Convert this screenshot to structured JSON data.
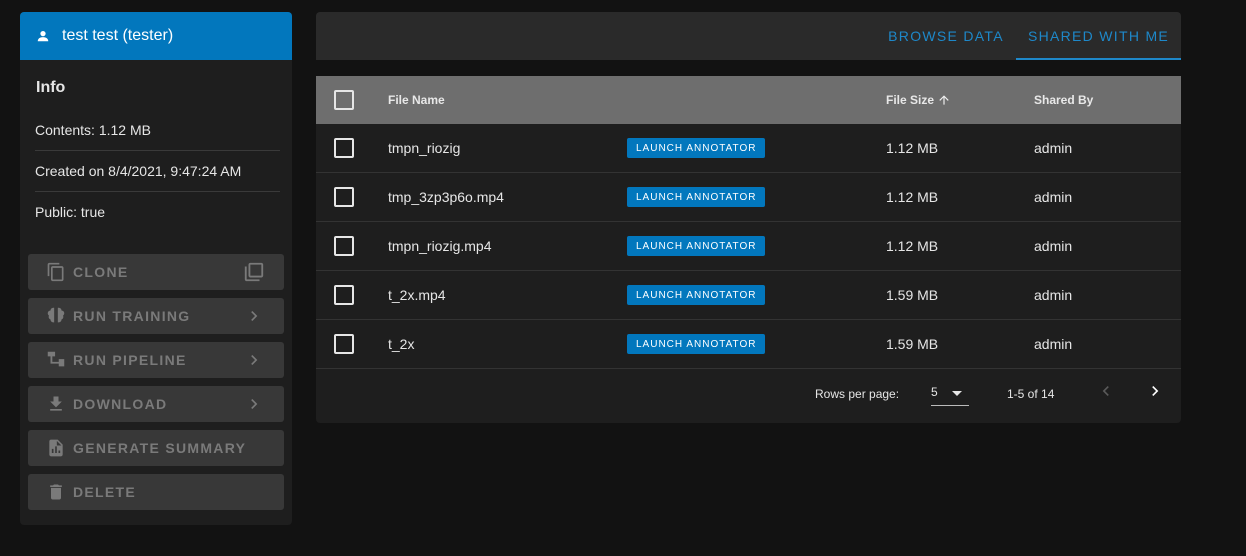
{
  "sidebar": {
    "user_label": "test test (tester)",
    "info_title": "Info",
    "contents": "Contents: 1.12 MB",
    "created": "Created on 8/4/2021, 9:47:24 AM",
    "public": "Public: true",
    "actions": [
      {
        "label": "CLONE",
        "icon": "clone-icon",
        "trail": "clone-library-icon"
      },
      {
        "label": "RUN TRAINING",
        "icon": "brain-icon",
        "trail": "chevron-right-icon"
      },
      {
        "label": "RUN PIPELINE",
        "icon": "pipeline-icon",
        "trail": "chevron-right-icon"
      },
      {
        "label": "DOWNLOAD",
        "icon": "download-icon",
        "trail": "chevron-right-icon"
      },
      {
        "label": "GENERATE SUMMARY",
        "icon": "document-chart-icon",
        "trail": ""
      },
      {
        "label": "DELETE",
        "icon": "trash-icon",
        "trail": ""
      }
    ]
  },
  "tabs": {
    "browse": "BROWSE DATA",
    "shared": "SHARED WITH ME",
    "active": "shared"
  },
  "table": {
    "headers": {
      "file_name": "File Name",
      "file_size": "File Size",
      "shared_by": "Shared By"
    },
    "launch_label": "LAUNCH ANNOTATOR",
    "rows": [
      {
        "name": "tmpn_riozig",
        "size": "1.12 MB",
        "shared_by": "admin"
      },
      {
        "name": "tmp_3zp3p6o.mp4",
        "size": "1.12 MB",
        "shared_by": "admin"
      },
      {
        "name": "tmpn_riozig.mp4",
        "size": "1.12 MB",
        "shared_by": "admin"
      },
      {
        "name": "t_2x.mp4",
        "size": "1.59 MB",
        "shared_by": "admin"
      },
      {
        "name": "t_2x",
        "size": "1.59 MB",
        "shared_by": "admin"
      }
    ]
  },
  "pager": {
    "rows_per_page_label": "Rows per page:",
    "rows_per_page": "5",
    "range": "1-5 of 14"
  },
  "colors": {
    "accent": "#0277bd",
    "tab_text": "#1e88c9"
  }
}
